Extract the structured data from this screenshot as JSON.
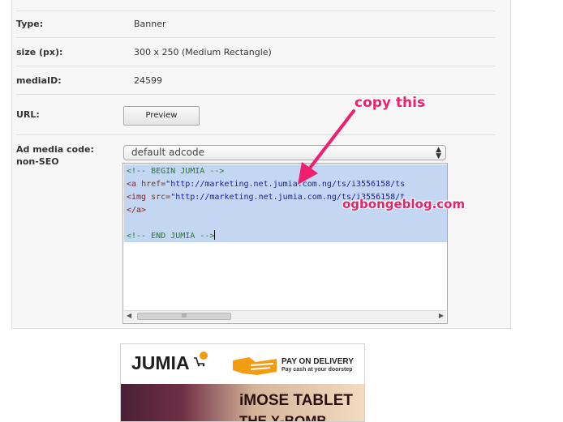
{
  "fields": {
    "type_label": "Type:",
    "type_value": "Banner",
    "size_label": "size (px):",
    "size_value": "300 x 250 (Medium Rectangle)",
    "media_label": "mediaID:",
    "media_value": "24599",
    "url_label": "URL:",
    "preview_button": "Preview",
    "adcode_label_1": "Ad media code:",
    "adcode_label_2": "non-SEO"
  },
  "select": {
    "value": "default adcode"
  },
  "code": {
    "line1": "<!-- BEGIN JUMIA -->",
    "line2_tag": "<a",
    "line2_attr": " href=",
    "line2_str": "\"http://marketing.net.jumia.com.ng/ts/i3556158/ts",
    "line3_tag": "<img",
    "line3_attr": " src=",
    "line3_str": "\"http://marketing.net.jumia.com.ng/ts/i3556158/t",
    "line4": "</a>",
    "line6": "<!-- END JUMIA -->"
  },
  "scroll": {
    "left_icon": "arrow-left-icon",
    "right_icon": "arrow-right-icon",
    "thumb_grip": "III"
  },
  "annotation": {
    "copy_text": "copy this",
    "watermark": "ogbongeblog.com",
    "color": "#f01e6e"
  },
  "banner": {
    "brand": "JUMIA",
    "pod_title": "PAY ON DELIVERY",
    "pod_sub": "Pay cash at your doorstep",
    "headline": "iMOSE TABLET",
    "subline": "THE X-BOMB",
    "accent": "#f39c12"
  }
}
